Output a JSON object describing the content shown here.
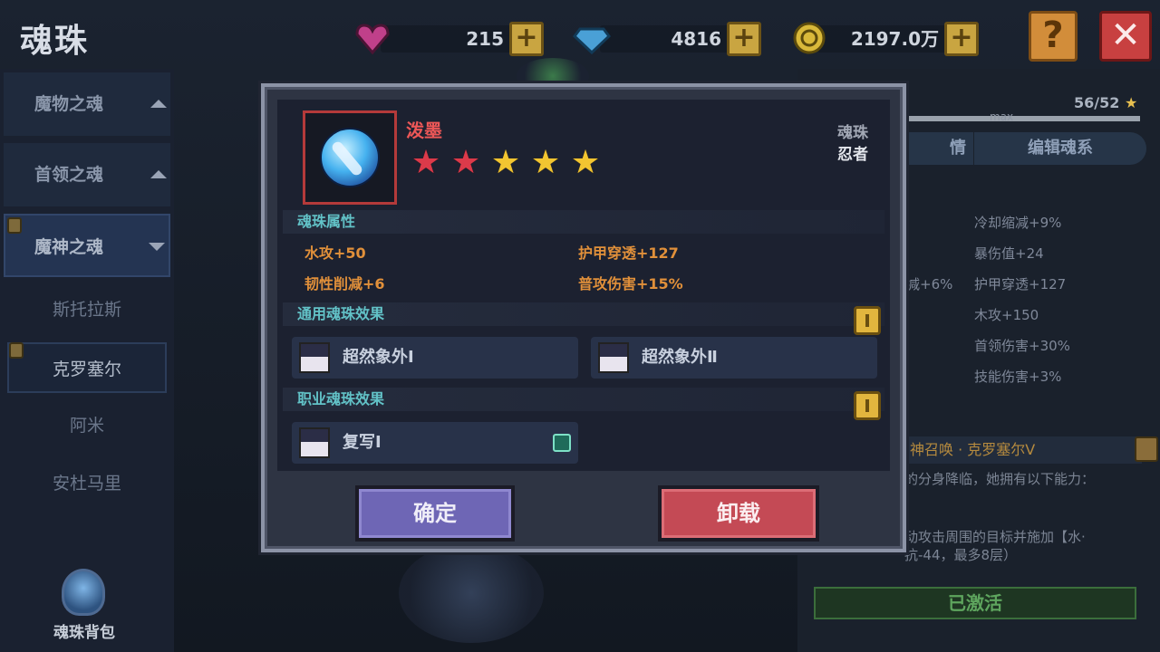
{
  "header": {
    "title": "魂珠",
    "resources": [
      {
        "name": "heart-gem",
        "value": "215",
        "color": "#c0408a"
      },
      {
        "name": "diamond",
        "value": "4816",
        "color": "#4aa0d6"
      },
      {
        "name": "gold-coin",
        "value": "2197.0万",
        "color": "#d9b93a"
      }
    ],
    "help_label": "?",
    "close_label": "✕"
  },
  "sidebar": {
    "categories": [
      {
        "label": "魔物之魂"
      },
      {
        "label": "首领之魂"
      },
      {
        "label": "魔神之魂"
      }
    ],
    "subitems": [
      {
        "label": "斯托拉斯"
      },
      {
        "label": "克罗塞尔"
      },
      {
        "label": "阿米"
      },
      {
        "label": "安杜马里"
      }
    ],
    "bag_label": "魂珠背包"
  },
  "right_panel": {
    "level": "56/52",
    "max_label": "max",
    "progress": 1.0,
    "tab_left": "情",
    "tab_right": "编辑魂系",
    "stats_left": [
      "减+6%"
    ],
    "stats_right": [
      "冷却缩减+9%",
      "暴伤值+24",
      "护甲穿透+127",
      "木攻+150",
      "首领伤害+30%",
      "技能伤害+3%"
    ],
    "skill_title": "神召唤 · 克罗塞尔Ⅴ",
    "desc_lines": [
      "的分身降临，她拥有以下能力：",
      "动攻击周围的目标并施加【水·",
      "抗-44，最多8层）"
    ],
    "status_label": "已激活"
  },
  "modal": {
    "orb_name": "泼墨",
    "stars_red": 2,
    "stars_gold": 3,
    "type_label": "魂珠",
    "class_label": "忍者",
    "attr_section": "魂珠属性",
    "attrs": [
      "水攻+50",
      "护甲穿透+127",
      "韧性削减+6",
      "普攻伤害+15%"
    ],
    "common_section": "通用魂珠效果",
    "common_effects": [
      "超然象外Ⅰ",
      "超然象外Ⅱ"
    ],
    "class_section": "职业魂珠效果",
    "class_effects": [
      "复写Ⅰ"
    ],
    "confirm_label": "确定",
    "unload_label": "卸载"
  }
}
